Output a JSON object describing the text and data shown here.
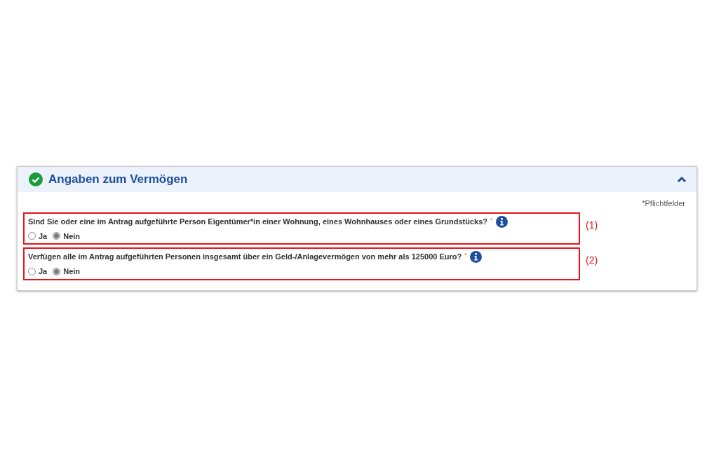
{
  "section": {
    "title": "Angaben zum Vermögen",
    "completed": true,
    "expanded": true
  },
  "required_note": "*Pflichtfelder",
  "questions": [
    {
      "text": "Sind Sie oder eine im Antrag aufgeführte Person Eigentümer*in einer Wohnung, eines Wohnhauses oder eines Grundstücks?",
      "required_mark": "*",
      "annotation": "(1)",
      "options": [
        {
          "label": "Ja",
          "selected": false
        },
        {
          "label": "Nein",
          "selected": true
        }
      ]
    },
    {
      "text": "Verfügen alle im Antrag aufgeführten Personen insgesamt über ein Geld-/Anlagevermögen von mehr als 125000 Euro?",
      "required_mark": "*",
      "annotation": "(2)",
      "options": [
        {
          "label": "Ja",
          "selected": false
        },
        {
          "label": "Nein",
          "selected": true
        }
      ]
    }
  ]
}
